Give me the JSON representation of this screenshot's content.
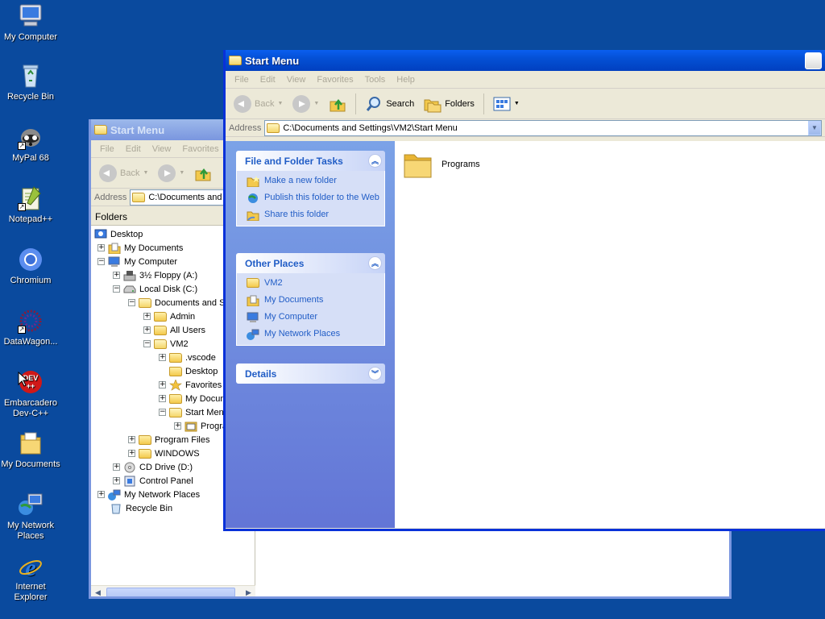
{
  "desktop": {
    "icons": [
      {
        "label": "My Computer",
        "icon": "my-computer-icon"
      },
      {
        "label": "Recycle Bin",
        "icon": "recycle-bin-icon"
      },
      {
        "label": "MyPal 68",
        "icon": "mypal-icon"
      },
      {
        "label": "Notepad++",
        "icon": "notepadpp-icon"
      },
      {
        "label": "Chromium",
        "icon": "chromium-icon"
      },
      {
        "label": "DataWagon...",
        "icon": "datawagon-icon"
      },
      {
        "label": "Embarcadero Dev-C++",
        "icon": "devcpp-icon"
      },
      {
        "label": "My Documents",
        "icon": "my-documents-icon"
      },
      {
        "label": "My Network Places",
        "icon": "network-places-icon"
      },
      {
        "label": "Internet Explorer",
        "icon": "internet-explorer-icon"
      }
    ],
    "shortcut_arrow": "↗"
  },
  "back_window": {
    "title": "Start Menu",
    "menu": [
      "File",
      "Edit",
      "View",
      "Favorites"
    ],
    "toolbar": {
      "back": "Back"
    },
    "address_label": "Address",
    "address_value": "C:\\Documents and",
    "folders_header": "Folders",
    "tree": [
      {
        "label": "Desktop",
        "pm": ""
      },
      {
        "label": "My Documents",
        "pm": "+"
      },
      {
        "label": "My Computer",
        "pm": "−"
      },
      {
        "label": "3½ Floppy (A:)",
        "pm": "+"
      },
      {
        "label": "Local Disk (C:)",
        "pm": "−"
      },
      {
        "label": "Documents and Se",
        "pm": "−"
      },
      {
        "label": "Admin",
        "pm": "+"
      },
      {
        "label": "All Users",
        "pm": "+"
      },
      {
        "label": "VM2",
        "pm": "−"
      },
      {
        "label": ".vscode",
        "pm": "+"
      },
      {
        "label": "Desktop",
        "pm": ""
      },
      {
        "label": "Favorites",
        "pm": "+"
      },
      {
        "label": "My Docum",
        "pm": "+"
      },
      {
        "label": "Start Menu",
        "pm": "−"
      },
      {
        "label": "Progra",
        "pm": "+"
      },
      {
        "label": "Program Files",
        "pm": "+"
      },
      {
        "label": "WINDOWS",
        "pm": "+"
      },
      {
        "label": "CD Drive (D:)",
        "pm": "+"
      },
      {
        "label": "Control Panel",
        "pm": "+"
      },
      {
        "label": "My Network Places",
        "pm": "+"
      },
      {
        "label": "Recycle Bin",
        "pm": ""
      }
    ]
  },
  "front_window": {
    "title": "Start Menu",
    "menu": [
      "File",
      "Edit",
      "View",
      "Favorites",
      "Tools",
      "Help"
    ],
    "toolbar": {
      "back": "Back",
      "search": "Search",
      "folders": "Folders"
    },
    "address_label": "Address",
    "address_value": "C:\\Documents and Settings\\VM2\\Start Menu",
    "task_pane": {
      "file_tasks": {
        "title": "File and Folder Tasks",
        "toggle": "︽",
        "links": [
          "Make a new folder",
          "Publish this folder to the Web",
          "Share this folder"
        ]
      },
      "other_places": {
        "title": "Other Places",
        "toggle": "︽",
        "links": [
          "VM2",
          "My Documents",
          "My Computer",
          "My Network Places"
        ]
      },
      "details": {
        "title": "Details",
        "toggle": "︾"
      }
    },
    "files": [
      {
        "name": "Programs"
      }
    ]
  }
}
